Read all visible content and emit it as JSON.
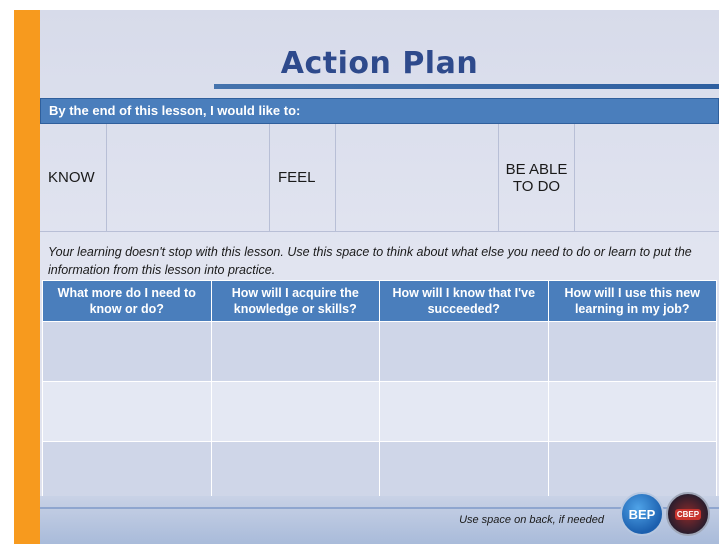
{
  "title": "Action Plan",
  "intro_bar": "By the end of this lesson, I would like to:",
  "goals": {
    "know": "KNOW",
    "feel": "FEEL",
    "be_able_line1": "BE ABLE",
    "be_able_line2": "TO DO"
  },
  "note": "Your learning doesn't stop with this lesson. Use this space to think about what else you need to do or learn to put the information from this lesson into practice.",
  "plan_headers": [
    "What more do I need to know or do?",
    "How will I acquire the knowledge or skills?",
    "How will I know that I've succeeded?",
    "How will I use this new learning in my job?"
  ],
  "footer_text": "Use space on back, if needed",
  "logos": {
    "bep": "BEP",
    "cbep": "CBEP"
  },
  "colors": {
    "accent_orange": "#f79a1e",
    "header_blue": "#4a7ebc",
    "title_blue": "#2e4a8c"
  }
}
